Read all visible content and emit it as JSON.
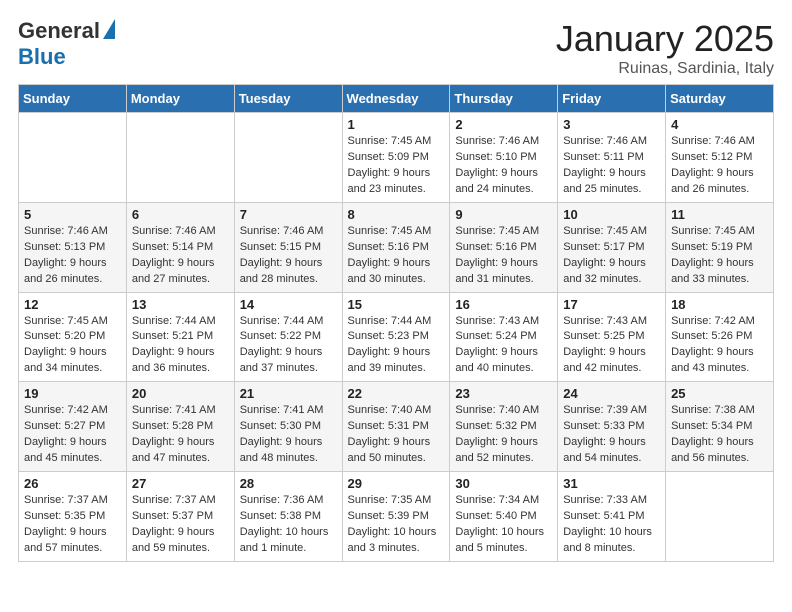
{
  "header": {
    "logo_general": "General",
    "logo_blue": "Blue",
    "month_title": "January 2025",
    "location": "Ruinas, Sardinia, Italy"
  },
  "weekdays": [
    "Sunday",
    "Monday",
    "Tuesday",
    "Wednesday",
    "Thursday",
    "Friday",
    "Saturday"
  ],
  "weeks": [
    [
      {
        "day": "",
        "info": ""
      },
      {
        "day": "",
        "info": ""
      },
      {
        "day": "",
        "info": ""
      },
      {
        "day": "1",
        "info": "Sunrise: 7:45 AM\nSunset: 5:09 PM\nDaylight: 9 hours and 23 minutes."
      },
      {
        "day": "2",
        "info": "Sunrise: 7:46 AM\nSunset: 5:10 PM\nDaylight: 9 hours and 24 minutes."
      },
      {
        "day": "3",
        "info": "Sunrise: 7:46 AM\nSunset: 5:11 PM\nDaylight: 9 hours and 25 minutes."
      },
      {
        "day": "4",
        "info": "Sunrise: 7:46 AM\nSunset: 5:12 PM\nDaylight: 9 hours and 26 minutes."
      }
    ],
    [
      {
        "day": "5",
        "info": "Sunrise: 7:46 AM\nSunset: 5:13 PM\nDaylight: 9 hours and 26 minutes."
      },
      {
        "day": "6",
        "info": "Sunrise: 7:46 AM\nSunset: 5:14 PM\nDaylight: 9 hours and 27 minutes."
      },
      {
        "day": "7",
        "info": "Sunrise: 7:46 AM\nSunset: 5:15 PM\nDaylight: 9 hours and 28 minutes."
      },
      {
        "day": "8",
        "info": "Sunrise: 7:45 AM\nSunset: 5:16 PM\nDaylight: 9 hours and 30 minutes."
      },
      {
        "day": "9",
        "info": "Sunrise: 7:45 AM\nSunset: 5:16 PM\nDaylight: 9 hours and 31 minutes."
      },
      {
        "day": "10",
        "info": "Sunrise: 7:45 AM\nSunset: 5:17 PM\nDaylight: 9 hours and 32 minutes."
      },
      {
        "day": "11",
        "info": "Sunrise: 7:45 AM\nSunset: 5:19 PM\nDaylight: 9 hours and 33 minutes."
      }
    ],
    [
      {
        "day": "12",
        "info": "Sunrise: 7:45 AM\nSunset: 5:20 PM\nDaylight: 9 hours and 34 minutes."
      },
      {
        "day": "13",
        "info": "Sunrise: 7:44 AM\nSunset: 5:21 PM\nDaylight: 9 hours and 36 minutes."
      },
      {
        "day": "14",
        "info": "Sunrise: 7:44 AM\nSunset: 5:22 PM\nDaylight: 9 hours and 37 minutes."
      },
      {
        "day": "15",
        "info": "Sunrise: 7:44 AM\nSunset: 5:23 PM\nDaylight: 9 hours and 39 minutes."
      },
      {
        "day": "16",
        "info": "Sunrise: 7:43 AM\nSunset: 5:24 PM\nDaylight: 9 hours and 40 minutes."
      },
      {
        "day": "17",
        "info": "Sunrise: 7:43 AM\nSunset: 5:25 PM\nDaylight: 9 hours and 42 minutes."
      },
      {
        "day": "18",
        "info": "Sunrise: 7:42 AM\nSunset: 5:26 PM\nDaylight: 9 hours and 43 minutes."
      }
    ],
    [
      {
        "day": "19",
        "info": "Sunrise: 7:42 AM\nSunset: 5:27 PM\nDaylight: 9 hours and 45 minutes."
      },
      {
        "day": "20",
        "info": "Sunrise: 7:41 AM\nSunset: 5:28 PM\nDaylight: 9 hours and 47 minutes."
      },
      {
        "day": "21",
        "info": "Sunrise: 7:41 AM\nSunset: 5:30 PM\nDaylight: 9 hours and 48 minutes."
      },
      {
        "day": "22",
        "info": "Sunrise: 7:40 AM\nSunset: 5:31 PM\nDaylight: 9 hours and 50 minutes."
      },
      {
        "day": "23",
        "info": "Sunrise: 7:40 AM\nSunset: 5:32 PM\nDaylight: 9 hours and 52 minutes."
      },
      {
        "day": "24",
        "info": "Sunrise: 7:39 AM\nSunset: 5:33 PM\nDaylight: 9 hours and 54 minutes."
      },
      {
        "day": "25",
        "info": "Sunrise: 7:38 AM\nSunset: 5:34 PM\nDaylight: 9 hours and 56 minutes."
      }
    ],
    [
      {
        "day": "26",
        "info": "Sunrise: 7:37 AM\nSunset: 5:35 PM\nDaylight: 9 hours and 57 minutes."
      },
      {
        "day": "27",
        "info": "Sunrise: 7:37 AM\nSunset: 5:37 PM\nDaylight: 9 hours and 59 minutes."
      },
      {
        "day": "28",
        "info": "Sunrise: 7:36 AM\nSunset: 5:38 PM\nDaylight: 10 hours and 1 minute."
      },
      {
        "day": "29",
        "info": "Sunrise: 7:35 AM\nSunset: 5:39 PM\nDaylight: 10 hours and 3 minutes."
      },
      {
        "day": "30",
        "info": "Sunrise: 7:34 AM\nSunset: 5:40 PM\nDaylight: 10 hours and 5 minutes."
      },
      {
        "day": "31",
        "info": "Sunrise: 7:33 AM\nSunset: 5:41 PM\nDaylight: 10 hours and 8 minutes."
      },
      {
        "day": "",
        "info": ""
      }
    ]
  ]
}
